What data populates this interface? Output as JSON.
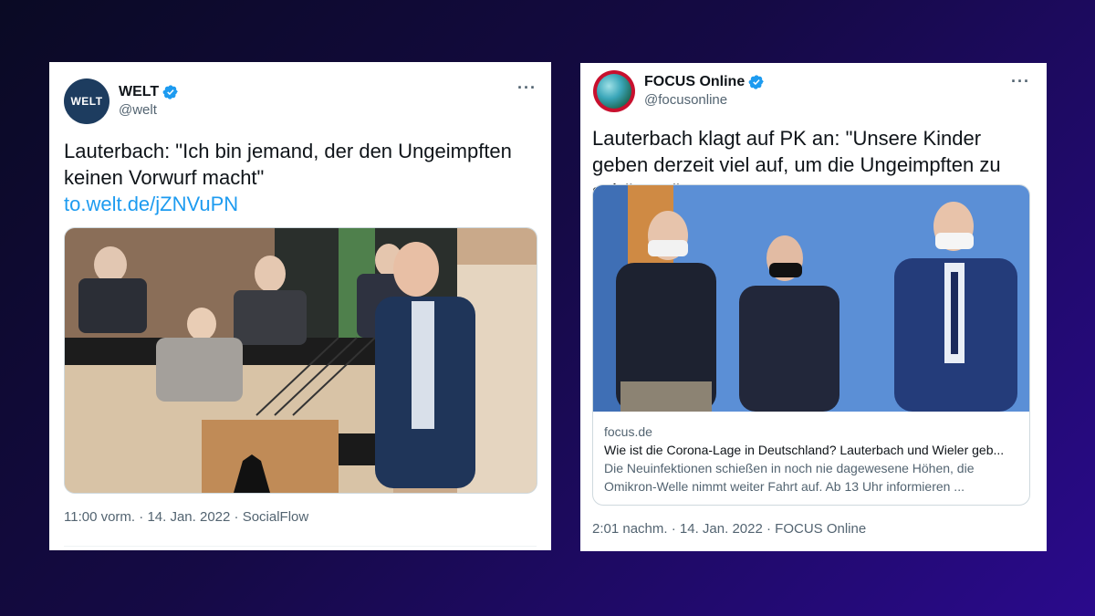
{
  "tweets": [
    {
      "avatar_text": "WELT",
      "display_name": "WELT",
      "handle": "@welt",
      "text": "Lauterbach: \"Ich bin jemand, der den Ungeimpften keinen Vorwurf macht\"",
      "link": "to.welt.de/jZNVuPN",
      "time": "11:00 vorm.",
      "date": "14. Jan. 2022",
      "source": "SocialFlow",
      "more": "···"
    },
    {
      "display_name": "FOCUS Online",
      "handle": "@focusonline",
      "text": "Lauterbach klagt auf PK an: \"Unsere Kinder geben derzeit viel auf, um die Ungeimpften zu schützen\"",
      "card_domain": "focus.de",
      "card_title": "Wie ist die Corona-Lage in Deutschland? Lauterbach und Wieler geb...",
      "card_description": "Die Neuinfektionen schießen in noch nie dagewesene Höhen, die Omikron-Welle nimmt weiter Fahrt auf. Ab 13 Uhr informieren ...",
      "time": "2:01 nachm.",
      "date": "14. Jan. 2022",
      "source": "FOCUS Online",
      "more": "···"
    }
  ],
  "separator": " · ",
  "colors": {
    "verified": "#1d9bf0",
    "link": "#1d9bf0",
    "welt_avatar": "#1d3c5f",
    "focus_avatar": "#c8102e"
  },
  "icons": [
    "verified-badge-icon",
    "more-options-icon"
  ]
}
